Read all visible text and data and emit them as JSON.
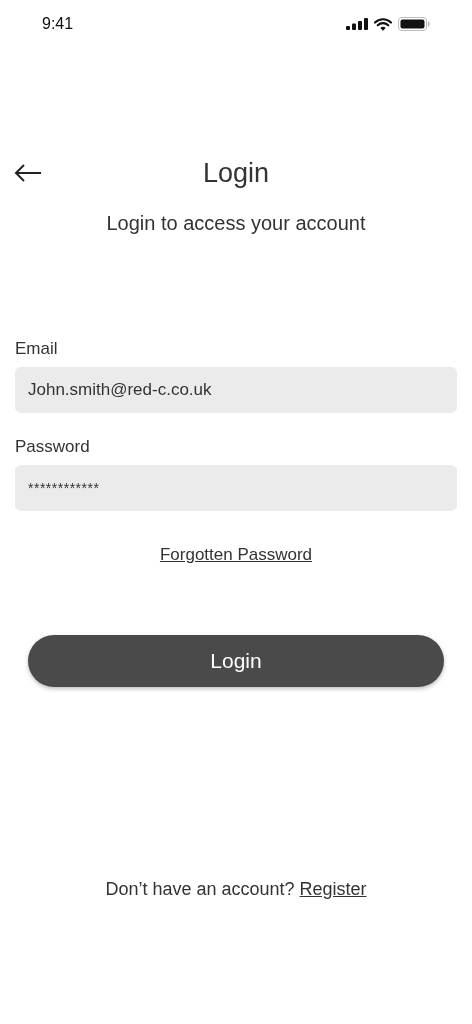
{
  "status_bar": {
    "time": "9:41"
  },
  "header": {
    "title": "Login"
  },
  "subtitle": "Login to access your account",
  "fields": [
    {
      "label": "Email",
      "value": "John.smith@red-c.co.uk",
      "kind": "text"
    },
    {
      "label": "Password",
      "value": "************",
      "kind": "password"
    }
  ],
  "forgot_link": "Forgotten Password",
  "login_button": "Login",
  "footer": {
    "prompt": "Don’t have an account?",
    "link": "Register"
  }
}
